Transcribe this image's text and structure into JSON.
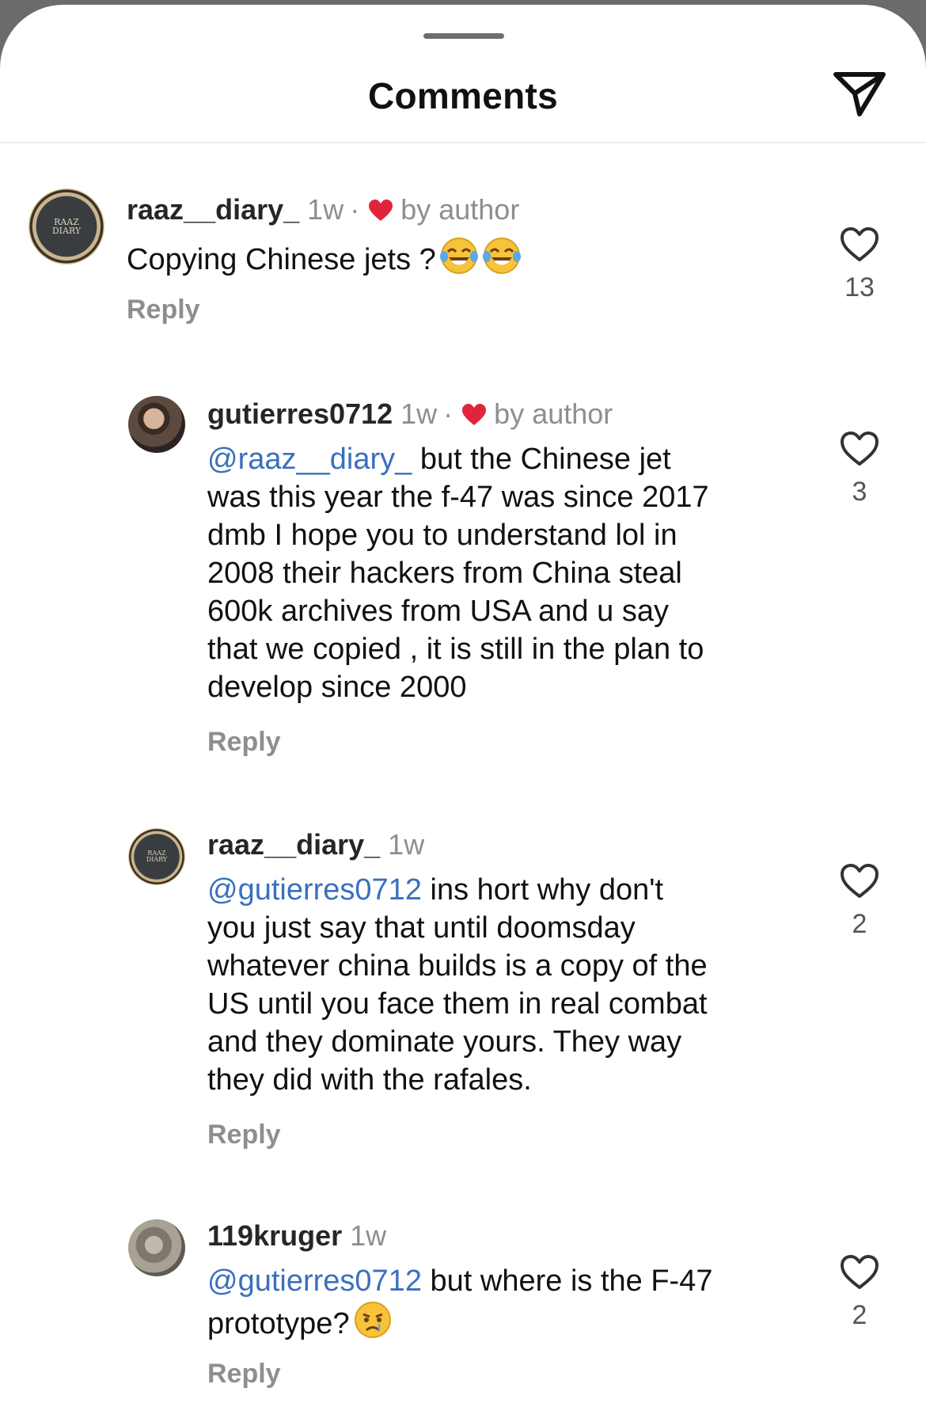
{
  "header": {
    "title": "Comments",
    "share_icon": "paper-plane-icon"
  },
  "colors": {
    "mention": "#3a6fbf",
    "heart": "#e0253a",
    "muted": "#8e8e8e",
    "text": "#111111"
  },
  "comments": [
    {
      "username": "raaz__diary_",
      "time": "1w",
      "separator": "·",
      "badge": "by author",
      "avatar_text_1": "RAAZ",
      "avatar_text_2": "DIARY",
      "text": "Copying Chinese jets ?",
      "emoji": [
        "tears-of-joy",
        "tears-of-joy"
      ],
      "reply": "Reply",
      "likes": "13"
    },
    {
      "username": "gutierres0712",
      "time": "1w",
      "separator": "·",
      "badge": "by author",
      "mention": "@raaz__diary_",
      "lines": [
        " but the Chinese jet",
        "was this year the f-47 was since 2017",
        "dmb I hope you to understand lol in",
        "2008 their hackers from China steal",
        "600k archives from USA and u say",
        "that we copied , it is still in the plan to",
        "develop since 2000"
      ],
      "reply": "Reply",
      "likes": "3"
    },
    {
      "username": "raaz__diary_",
      "time": "1w",
      "avatar_text_1": "RAAZ",
      "avatar_text_2": "DIARY",
      "mention": "@gutierres0712",
      "lines": [
        " ins hort why don't",
        "you just say that until doomsday",
        "whatever china builds is a copy of the",
        "US until you face them in real combat",
        "and they dominate yours. They way",
        "they did with the rafales."
      ],
      "reply": "Reply",
      "likes": "2"
    },
    {
      "username": "119kruger",
      "time": "1w",
      "mention": "@gutierres0712",
      "lines": [
        " but where is the F-47",
        "prototype?"
      ],
      "emoji": [
        "crying-face"
      ],
      "reply": "Reply",
      "likes": "2"
    }
  ]
}
